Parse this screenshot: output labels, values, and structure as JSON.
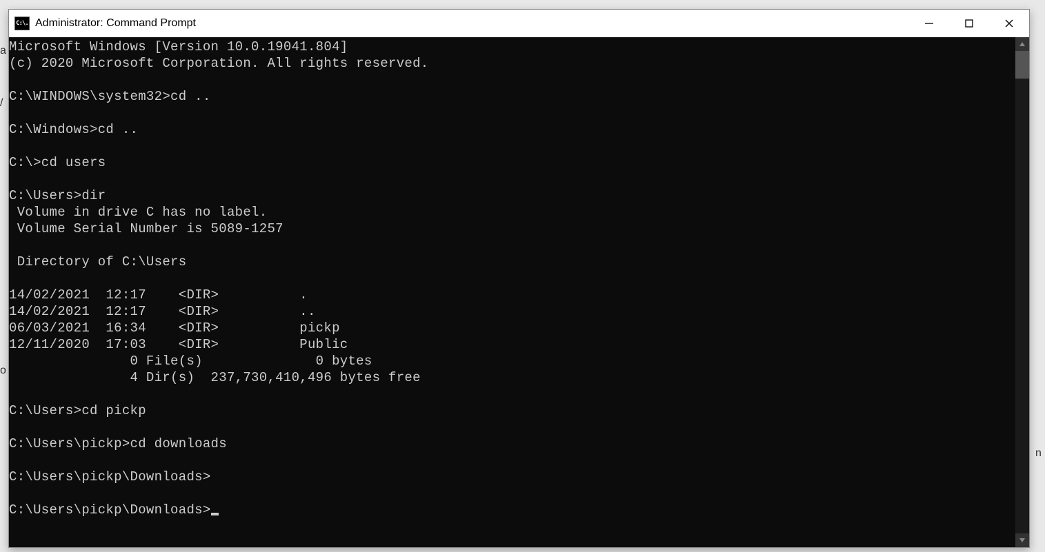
{
  "window": {
    "title": "Administrator: Command Prompt",
    "icon_text": "C:\\."
  },
  "terminal": {
    "lines": [
      "Microsoft Windows [Version 10.0.19041.804]",
      "(c) 2020 Microsoft Corporation. All rights reserved.",
      "",
      "C:\\WINDOWS\\system32>cd ..",
      "",
      "C:\\Windows>cd ..",
      "",
      "C:\\>cd users",
      "",
      "C:\\Users>dir",
      " Volume in drive C has no label.",
      " Volume Serial Number is 5089-1257",
      "",
      " Directory of C:\\Users",
      "",
      "14/02/2021  12:17    <DIR>          .",
      "14/02/2021  12:17    <DIR>          ..",
      "06/03/2021  16:34    <DIR>          pickp",
      "12/11/2020  17:03    <DIR>          Public",
      "               0 File(s)              0 bytes",
      "               4 Dir(s)  237,730,410,496 bytes free",
      "",
      "C:\\Users>cd pickp",
      "",
      "C:\\Users\\pickp>cd downloads",
      "",
      "C:\\Users\\pickp\\Downloads>",
      "",
      "C:\\Users\\pickp\\Downloads>"
    ],
    "cursor_on_last": true
  }
}
